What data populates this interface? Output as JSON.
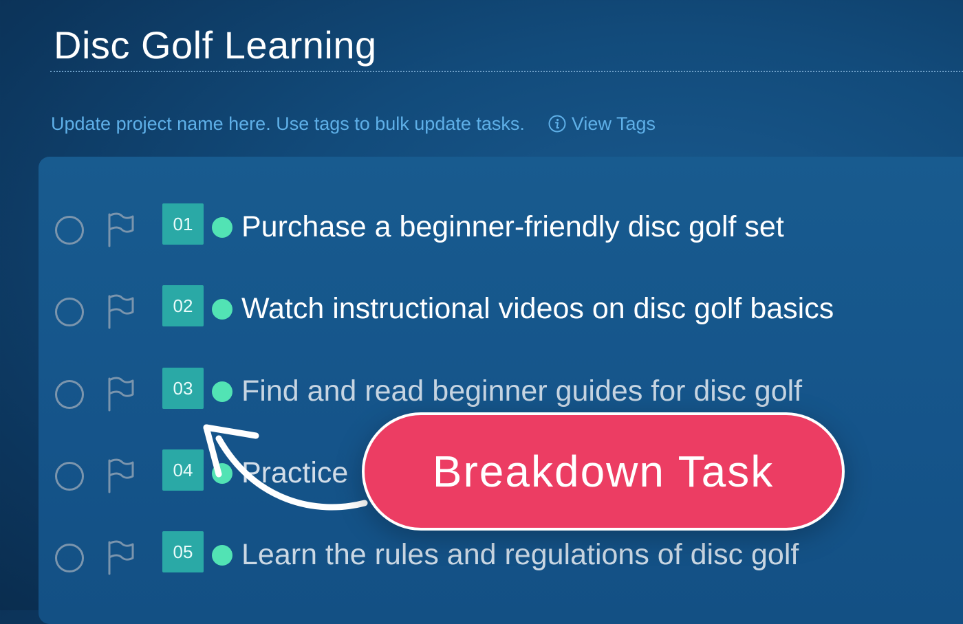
{
  "project": {
    "title": "Disc Golf Learning",
    "hint": "Update project name here. Use tags to bulk update tasks.",
    "view_tags_label": "View Tags"
  },
  "tasks": [
    {
      "number": "01",
      "text": "Purchase a beginner-friendly disc golf set",
      "status_color": "#52e3b4"
    },
    {
      "number": "02",
      "text": "Watch instructional videos on disc golf basics",
      "status_color": "#52e3b4"
    },
    {
      "number": "03",
      "text": "Find and read beginner guides for disc golf",
      "status_color": "#52e3b4"
    },
    {
      "number": "04",
      "text": "Practice",
      "status_color": "#52e3b4"
    },
    {
      "number": "05",
      "text": "Learn the rules and regulations of disc golf",
      "status_color": "#52e3b4"
    }
  ],
  "callout": {
    "label": "Breakdown Task",
    "color": "#ec3d63"
  },
  "icons": {
    "complete": "circle-outline-icon",
    "priority": "flag-outline-icon",
    "info": "info-circle-icon",
    "arrow": "curved-arrow-icon"
  },
  "colors": {
    "accent_link": "#5fb0e8",
    "badge": "#2aa9a6",
    "status_dot": "#52e3b4"
  }
}
